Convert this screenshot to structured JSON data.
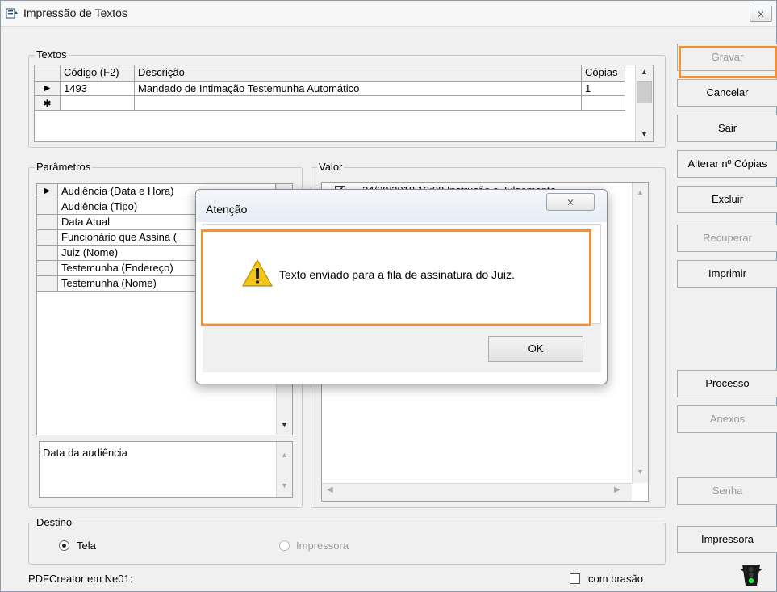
{
  "window": {
    "title": "Impressão de Textos",
    "close_glyph": "⨯"
  },
  "textos": {
    "label": "Textos",
    "headers": [
      "Código (F2)",
      "Descrição",
      "Cópias"
    ],
    "rows": [
      {
        "marker": "▶",
        "codigo": "1493",
        "descricao": "Mandado de Intimação Testemunha Automático",
        "copias": "1"
      },
      {
        "marker": "✱",
        "codigo": "",
        "descricao": "",
        "copias": ""
      }
    ]
  },
  "parametros": {
    "label": "Parâmetros",
    "items": [
      "Audiência (Data e Hora)",
      "Audiência (Tipo)",
      "Data Atual",
      "Funcionário que Assina (",
      "Juiz (Nome)",
      "Testemunha (Endereço)",
      "Testemunha (Nome)"
    ],
    "description": "Data da audiência"
  },
  "valor": {
    "label": "Valor",
    "first_item": "24/08/2018 13:00 Instrução e Julgamento"
  },
  "destino": {
    "label": "Destino",
    "option_tela": "Tela",
    "option_impressora": "Impressora"
  },
  "footer": {
    "printer_label": "PDFCreator em Ne01:",
    "brasao_label": "com brasão"
  },
  "buttons": {
    "gravar": "Gravar",
    "cancelar": "Cancelar",
    "sair": "Sair",
    "alterar_copias": "Alterar nº Cópias",
    "excluir": "Excluir",
    "recuperar": "Recuperar",
    "imprimir": "Imprimir",
    "processo": "Processo",
    "anexos": "Anexos",
    "senha": "Senha",
    "impressora": "Impressora"
  },
  "dialog": {
    "title": "Atenção",
    "message": "Texto enviado para a fila de assinatura do Juiz.",
    "ok": "OK",
    "close_glyph": "⨯"
  },
  "colors": {
    "highlight": "#f0913a",
    "warning": "#f5c518"
  }
}
